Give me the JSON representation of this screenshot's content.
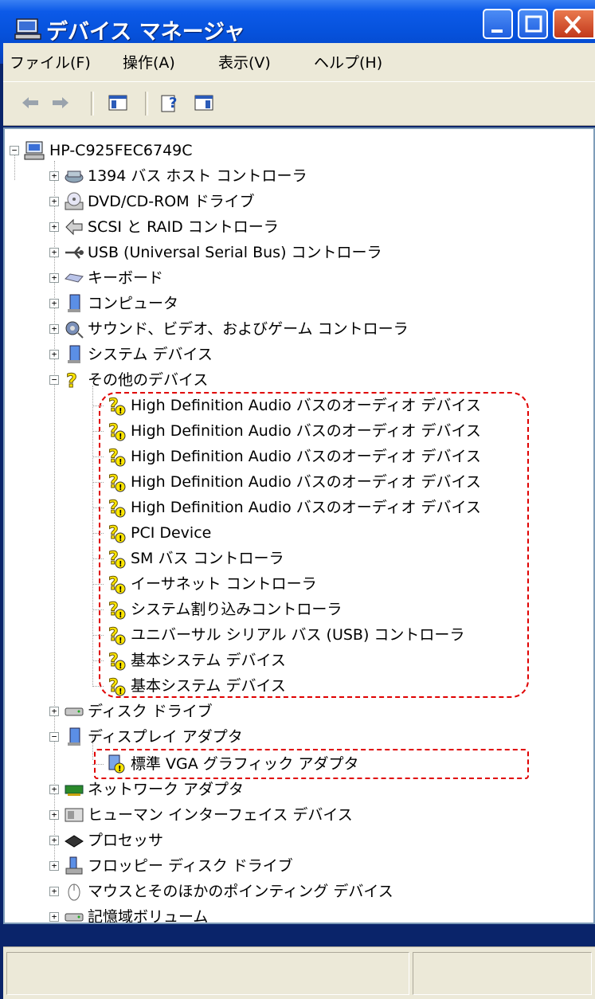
{
  "window": {
    "title": "デバイス マネージャ"
  },
  "menu": [
    "ファイル(F)",
    "操作(A)",
    "表示(V)",
    "ヘルプ(H)"
  ],
  "tree": {
    "root": "HP-C925FEC6749C",
    "categories_top": [
      {
        "label": "1394 バス ホスト コントローラ",
        "icon": "firewire-icon"
      },
      {
        "label": "DVD/CD-ROM ドライブ",
        "icon": "cdrom-icon"
      },
      {
        "label": "SCSI と RAID コントローラ",
        "icon": "scsi-icon"
      },
      {
        "label": "USB (Universal Serial Bus) コントローラ",
        "icon": "usb-icon"
      },
      {
        "label": "キーボード",
        "icon": "keyboard-icon"
      },
      {
        "label": "コンピュータ",
        "icon": "computer-icon"
      },
      {
        "label": "サウンド、ビデオ、およびゲーム コントローラ",
        "icon": "sound-icon"
      },
      {
        "label": "システム デバイス",
        "icon": "system-device-icon"
      }
    ],
    "other_devices": {
      "label": "その他のデバイス",
      "items": [
        "High Definition Audio バスのオーディオ デバイス",
        "High Definition Audio バスのオーディオ デバイス",
        "High Definition Audio バスのオーディオ デバイス",
        "High Definition Audio バスのオーディオ デバイス",
        "High Definition Audio バスのオーディオ デバイス",
        "PCI Device",
        "SM バス コントローラ",
        "イーサネット コントローラ",
        "システム割り込みコントローラ",
        "ユニバーサル シリアル バス (USB) コントローラ",
        "基本システム デバイス",
        "基本システム デバイス"
      ]
    },
    "disk_drives": {
      "label": "ディスク ドライブ"
    },
    "display_adapters": {
      "label": "ディスプレイ アダプタ",
      "items": [
        "標準 VGA グラフィック アダプタ"
      ]
    },
    "categories_bottom": [
      {
        "label": "ネットワーク アダプタ",
        "icon": "network-adapter-icon"
      },
      {
        "label": "ヒューマン インターフェイス デバイス",
        "icon": "hid-icon"
      },
      {
        "label": "プロセッサ",
        "icon": "processor-icon"
      },
      {
        "label": "フロッピー ディスク ドライブ",
        "icon": "floppy-icon"
      },
      {
        "label": "マウスとそのほかのポインティング デバイス",
        "icon": "mouse-icon"
      },
      {
        "label": "記憶域ボリューム",
        "icon": "storage-volume-icon"
      }
    ]
  },
  "colors": {
    "title_blue": "#0652dc",
    "highlight_red": "#e00000",
    "warning_yellow": "#ffe600"
  }
}
